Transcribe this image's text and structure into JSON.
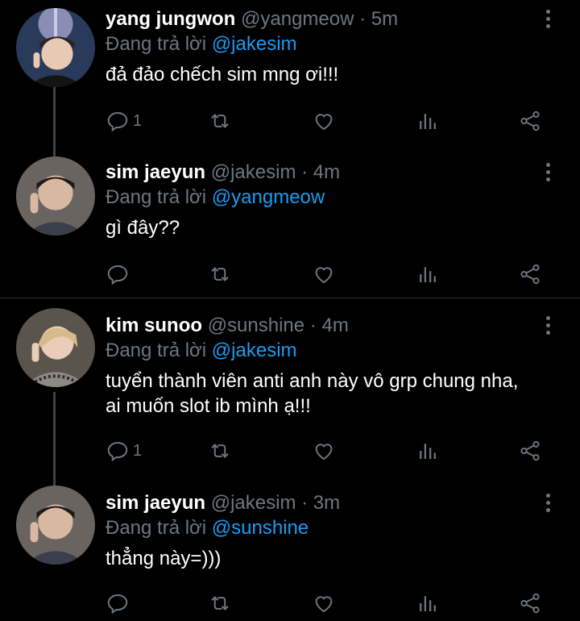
{
  "tweets": [
    {
      "name": "yang jungwon",
      "handle": "@yangmeow",
      "dot": "·",
      "time": "5m",
      "reply_prefix": "Đang trả lời",
      "reply_to": "@jakesim",
      "text": [
        "đả đảo chếch sim mng ơi!!!"
      ],
      "reply_count": "1",
      "avatar_icon": "avatar-photo"
    },
    {
      "name": "sim jaeyun",
      "handle": "@jakesim",
      "dot": "·",
      "time": "4m",
      "reply_prefix": "Đang trả lời",
      "reply_to": "@yangmeow",
      "text": [
        "gì đây??"
      ],
      "reply_count": "",
      "avatar_icon": "avatar-photo"
    },
    {
      "name": "kim sunoo",
      "handle": "@sunshine",
      "dot": "·",
      "time": "4m",
      "reply_prefix": "Đang trả lời",
      "reply_to": "@jakesim",
      "text": [
        "tuyển thành viên anti anh này vô grp chung nha,",
        "ai muốn slot ib mình ạ!!!"
      ],
      "reply_count": "1",
      "avatar_icon": "avatar-photo"
    },
    {
      "name": "sim jaeyun",
      "handle": "@jakesim",
      "dot": "·",
      "time": "3m",
      "reply_prefix": "Đang trả lời",
      "reply_to": "@sunshine",
      "text": [
        "thẳng này=)))"
      ],
      "reply_count": "",
      "avatar_icon": "avatar-photo"
    }
  ],
  "colors": {
    "background": "#000000",
    "muted": "#6e767d",
    "mention": "#1d9bf0",
    "thread_line": "#3d4248"
  },
  "icons": [
    "reply-icon",
    "retweet-icon",
    "like-icon",
    "analytics-icon",
    "share-icon",
    "more-icon"
  ]
}
